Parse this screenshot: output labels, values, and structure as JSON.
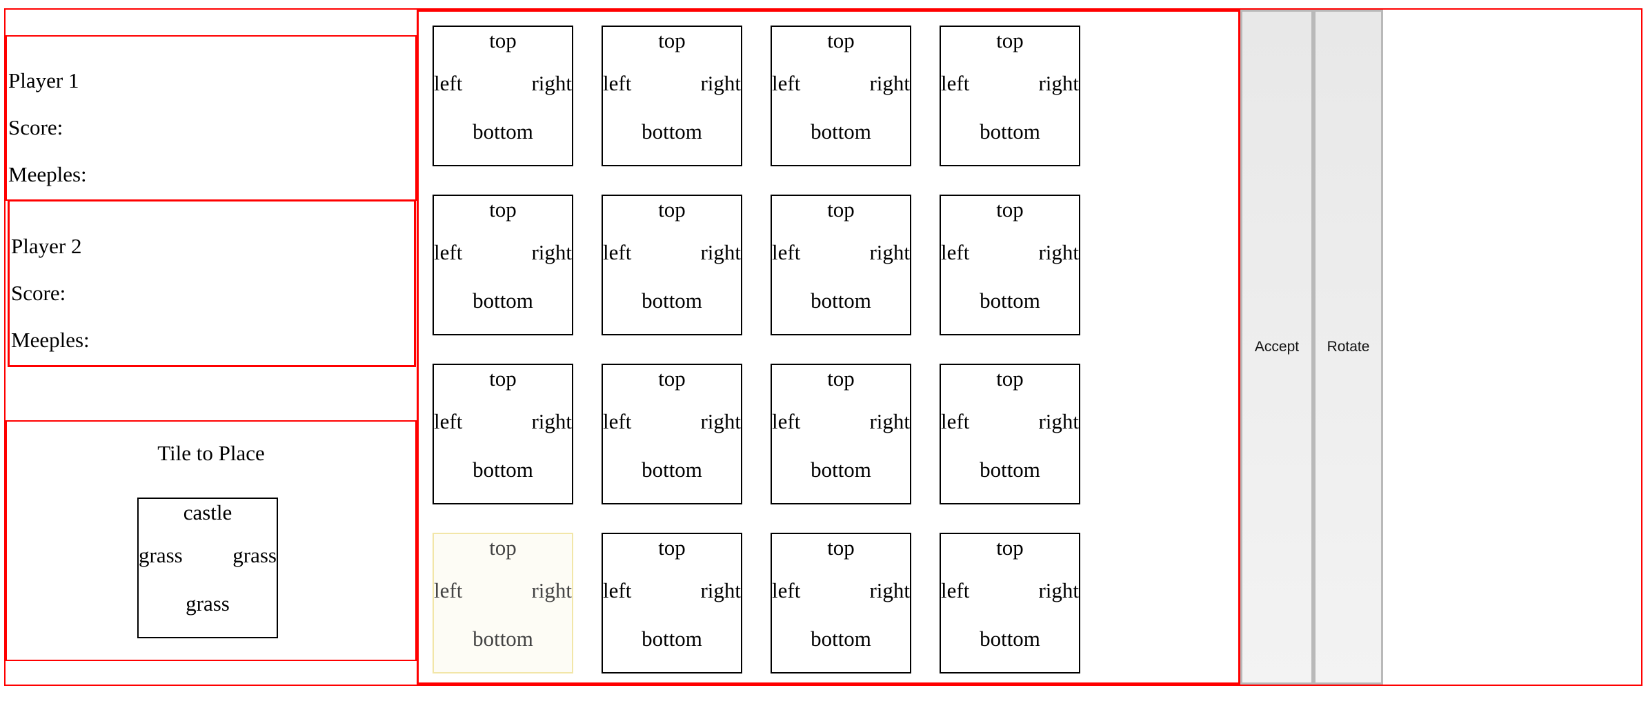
{
  "players": [
    {
      "name": "Player 1",
      "score_label": "Score:",
      "meeples_label": "Meeples:"
    },
    {
      "name": "Player 2",
      "score_label": "Score:",
      "meeples_label": "Meeples:"
    }
  ],
  "tile_to_place": {
    "title": "Tile to Place",
    "top": "castle",
    "left": "grass",
    "right": "grass",
    "bottom": "grass"
  },
  "board": {
    "tile_labels": {
      "top": "top",
      "left": "left",
      "right": "right",
      "bottom": "bottom"
    },
    "rows": 4,
    "cols": 4,
    "highlighted_tile": {
      "row": 4,
      "col": 1
    }
  },
  "buttons": {
    "accept": "Accept",
    "rotate": "Rotate"
  }
}
